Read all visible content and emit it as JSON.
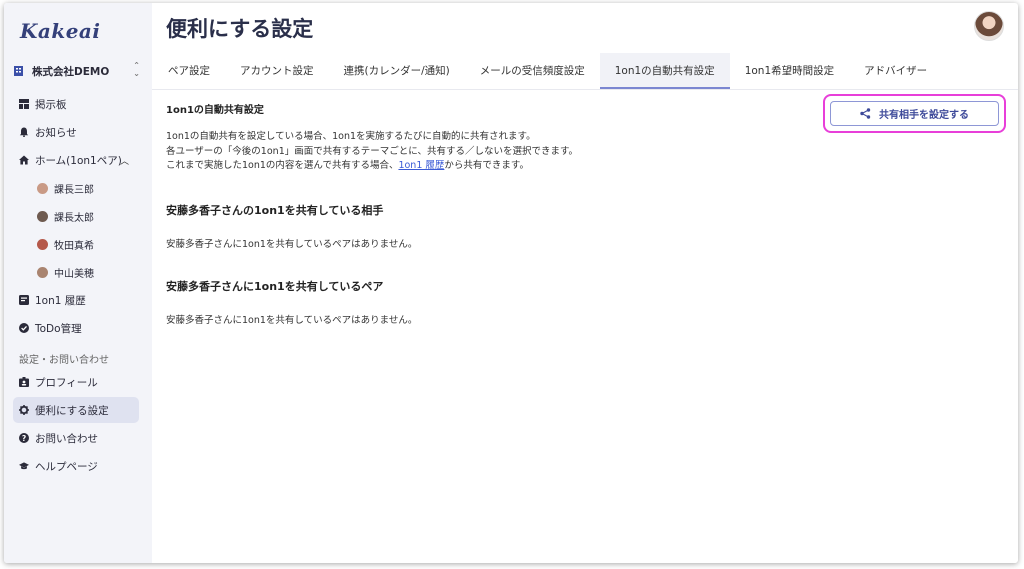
{
  "app": {
    "logo": "Kakeai"
  },
  "company": {
    "name": "株式会社DEMO",
    "switch_icon": "unfold-icon"
  },
  "sidebar": {
    "items": [
      {
        "label": "掲示板",
        "icon": "board-icon"
      },
      {
        "label": "お知らせ",
        "icon": "bell-icon"
      },
      {
        "label": "ホーム(1on1ペア)",
        "icon": "home-icon",
        "expanded": true
      },
      {
        "label": "課長三郎",
        "avatar_color": "#c99a86"
      },
      {
        "label": "課長太郎",
        "avatar_color": "#6e5a50"
      },
      {
        "label": "牧田真希",
        "avatar_color": "#b5584a"
      },
      {
        "label": "中山美穂",
        "avatar_color": "#a98470"
      },
      {
        "label": "1on1 履歴",
        "icon": "history-icon"
      },
      {
        "label": "ToDo管理",
        "icon": "check-circle-icon"
      }
    ],
    "section_label": "設定・お問い合わせ",
    "settings_items": [
      {
        "label": "プロフィール",
        "icon": "profile-icon"
      },
      {
        "label": "便利にする設定",
        "icon": "gear-icon",
        "active": true
      },
      {
        "label": "お問い合わせ",
        "icon": "question-icon"
      },
      {
        "label": "ヘルプページ",
        "icon": "graduation-cap-icon"
      }
    ]
  },
  "header": {
    "title": "便利にする設定"
  },
  "tabs": [
    {
      "label": "ペア設定"
    },
    {
      "label": "アカウント設定"
    },
    {
      "label": "連携(カレンダー/通知)"
    },
    {
      "label": "メールの受信頻度設定"
    },
    {
      "label": "1on1の自動共有設定",
      "active": true
    },
    {
      "label": "1on1希望時間設定"
    },
    {
      "label": "アドバイザー"
    }
  ],
  "content": {
    "heading": "1on1の自動共有設定",
    "desc_line1": "1on1の自動共有を設定している場合、1on1を実施するたびに自動的に共有されます。",
    "desc_line2": "各ユーザーの「今後の1on1」画面で共有するテーマごとに、共有する／しないを選択できます。",
    "desc_line3_pre": "これまで実施した1on1の内容を選んで共有する場合、",
    "desc_line3_link": "1on1 履歴",
    "desc_line3_post": "から共有できます。",
    "section1_title": "安藤多香子さんの1on1を共有している相手",
    "section1_text": "安藤多香子さんに1on1を共有しているペアはありません。",
    "section2_title": "安藤多香子さんに1on1を共有しているペア",
    "section2_text": "安藤多香子さんに1on1を共有しているペアはありません。"
  },
  "share_button": {
    "label": "共有相手を設定する",
    "icon": "share-icon"
  },
  "colors": {
    "accent": "#7b86d1",
    "highlight": "#e83fd9",
    "sidebar_bg": "#f3f4f9",
    "title": "#2a2f4a"
  }
}
